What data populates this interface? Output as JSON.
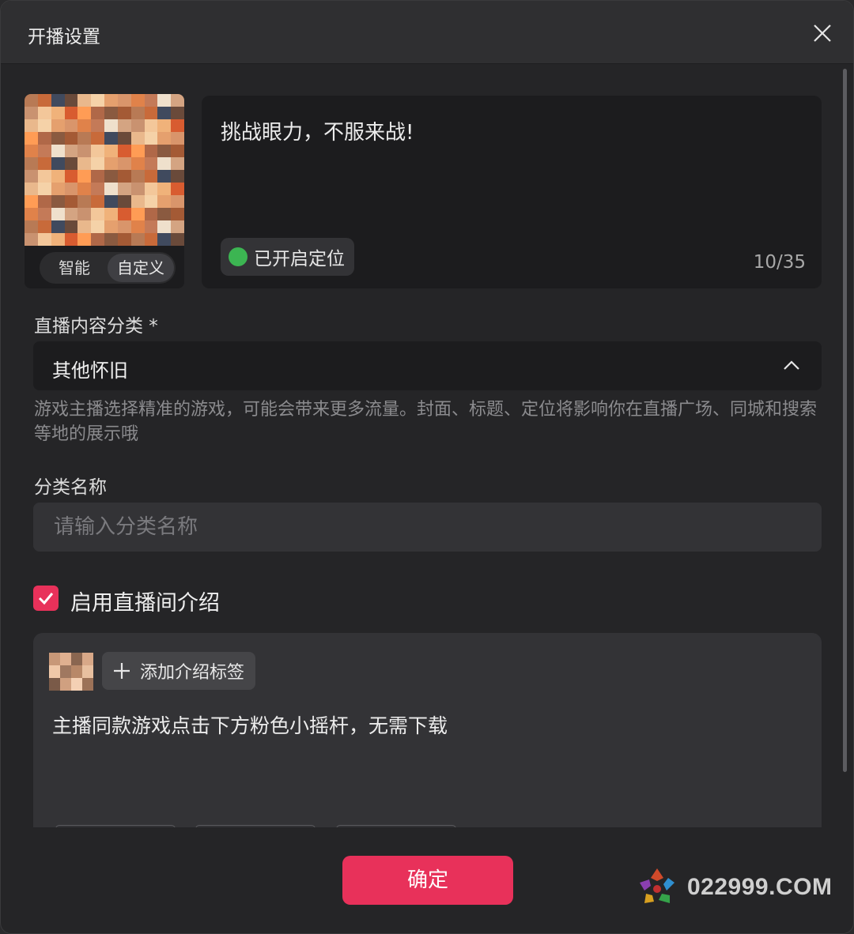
{
  "dialog": {
    "title": "开播设置",
    "close_icon": "close-icon"
  },
  "cover": {
    "segment": [
      "智能",
      "自定义"
    ],
    "selected": "自定义"
  },
  "live_title": {
    "text": "挑战眼力，不服来战!",
    "location": "已开启定位",
    "location_color": "#3cb552",
    "counter": "10/35"
  },
  "category": {
    "label": "直播内容分类 *",
    "value": "其他怀旧",
    "hint": "游戏主播选择精准的游戏，可能会带来更多流量。封面、标题、定位将影响你在直播广场、同城和搜索等地的展示哦"
  },
  "category_name": {
    "label": "分类名称",
    "placeholder": "请输入分类名称",
    "value": ""
  },
  "intro": {
    "enable_label": "启用直播间介绍",
    "enabled": true,
    "add_tag": "添加介绍标签",
    "text": "主播同款游戏点击下方粉色小摇杆，无需下载"
  },
  "confirm": "确定",
  "watermark": "022999.COM",
  "colors": {
    "accent": "#e8315a",
    "bg": "#252527",
    "field": "#1c1c1e"
  }
}
